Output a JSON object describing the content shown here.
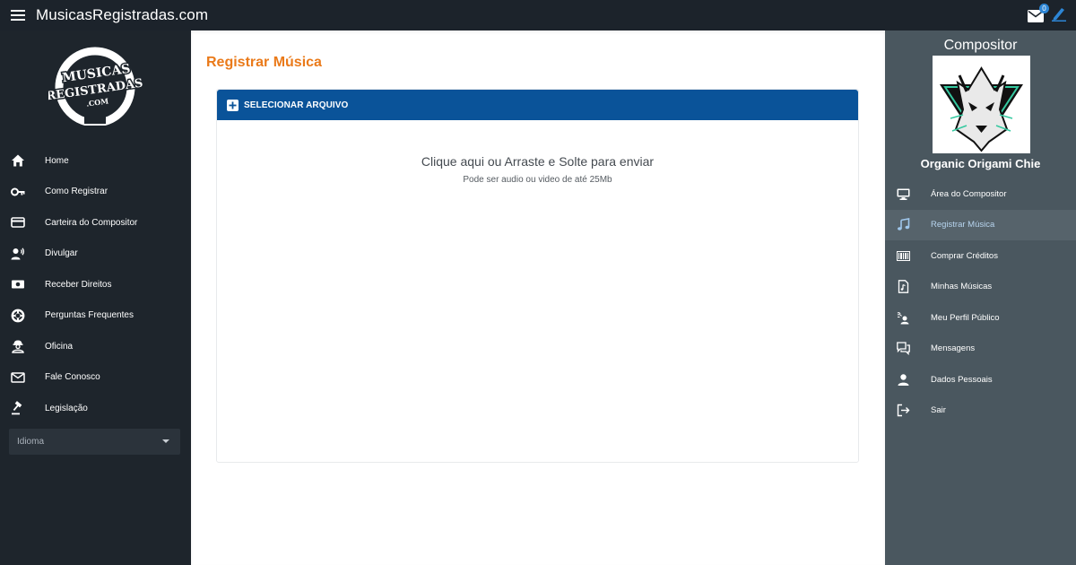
{
  "header": {
    "app_title": "MusicasRegistradas.com",
    "mail_count": "0"
  },
  "logo": {
    "line1": "MUSICAS",
    "line2": "REGISTRADAS",
    "line3": ".COM"
  },
  "left_nav": {
    "items": [
      {
        "label": "Home",
        "icon": "home-icon"
      },
      {
        "label": "Como Registrar",
        "icon": "key-icon"
      },
      {
        "label": "Carteira do Compositor",
        "icon": "card-icon"
      },
      {
        "label": "Divulgar",
        "icon": "voice-icon"
      },
      {
        "label": "Receber Direitos",
        "icon": "money-icon"
      },
      {
        "label": "Perguntas Frequentes",
        "icon": "lifebuoy-icon"
      },
      {
        "label": "Oficina",
        "icon": "engineer-icon"
      },
      {
        "label": "Fale Conosco",
        "icon": "mail-icon"
      },
      {
        "label": "Legislação",
        "icon": "gavel-icon"
      }
    ],
    "language_select": "Idioma"
  },
  "main": {
    "page_title": "Registrar Música",
    "upload_button": "SELECIONAR ARQUIVO",
    "drop_main": "Clique aqui ou Arraste e Solte para enviar",
    "drop_sub": "Pode ser audio ou video de até 25Mb"
  },
  "right_panel": {
    "heading": "Compositor",
    "composer_name": "Organic Origami Chie",
    "items": [
      {
        "label": "Área do Compositor",
        "icon": "monitor-icon"
      },
      {
        "label": "Registrar Música",
        "icon": "music-note-icon"
      },
      {
        "label": "Comprar Créditos",
        "icon": "barcode-icon"
      },
      {
        "label": "Minhas Músicas",
        "icon": "music-file-icon"
      },
      {
        "label": "Meu Perfil Público",
        "icon": "profile-signal-icon"
      },
      {
        "label": "Mensagens",
        "icon": "chat-icon"
      },
      {
        "label": "Dados Pessoais",
        "icon": "person-icon"
      },
      {
        "label": "Sair",
        "icon": "logout-icon"
      }
    ]
  },
  "colors": {
    "topbar": "#1c232b",
    "left_sidebar": "#1e252c",
    "right_sidebar": "#4a575f",
    "accent_orange": "#ea7a1a",
    "upload_blue": "#0a5399"
  }
}
